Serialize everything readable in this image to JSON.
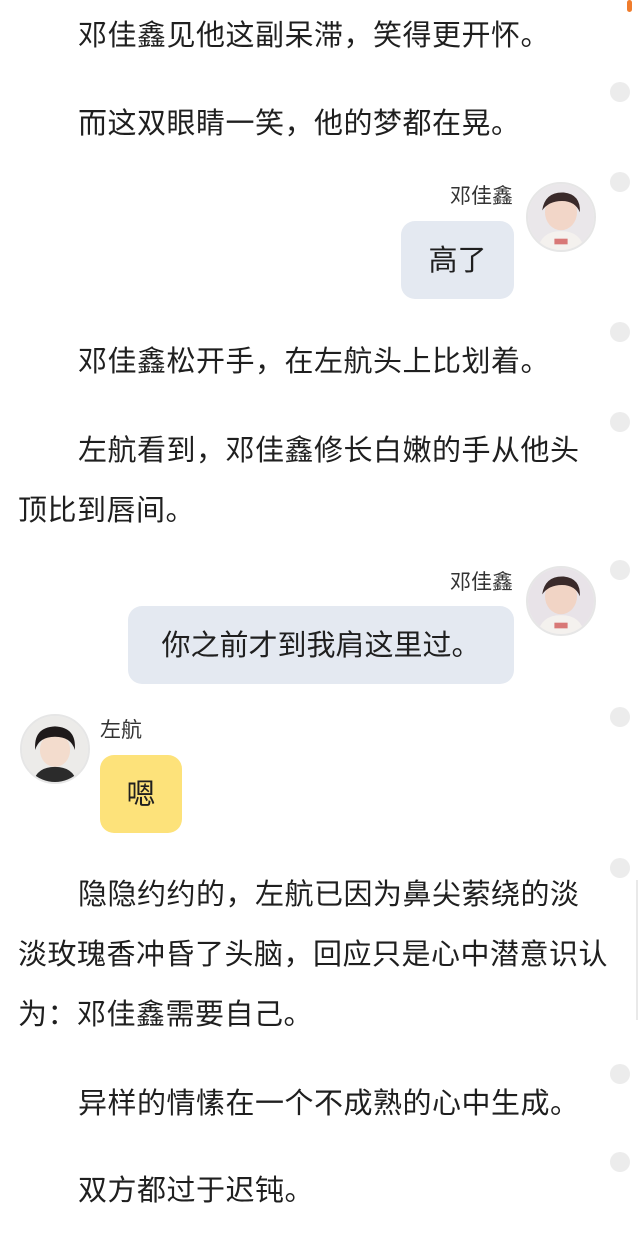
{
  "paragraphs": {
    "p1": "邓佳鑫见他这副呆滞，笑得更开怀。",
    "p2": "而这双眼睛一笑，他的梦都在晃。",
    "p3": "邓佳鑫松开手，在左航头上比划着。",
    "p4": "左航看到，邓佳鑫修长白嫩的手从他头顶比到唇间。",
    "p5": "隐隐约约的，左航已因为鼻尖萦绕的淡淡玫瑰香冲昏了头脑，回应只是心中潜意识认为：邓佳鑫需要自己。",
    "p6": "异样的情愫在一个不成熟的心中生成。",
    "p7": "双方都过于迟钝。"
  },
  "messages": [
    {
      "sender": "邓佳鑫",
      "side": "right",
      "text": "高了",
      "bubble_color": "#e4e9f1"
    },
    {
      "sender": "邓佳鑫",
      "side": "right",
      "text": "你之前才到我肩这里过。",
      "bubble_color": "#e4e9f1"
    },
    {
      "sender": "左航",
      "side": "left",
      "text": "嗯",
      "bubble_color": "#fde27a"
    }
  ],
  "colors": {
    "accent": "#f07c2c",
    "right_bubble": "#e4e9f1",
    "left_bubble": "#fde27a"
  }
}
